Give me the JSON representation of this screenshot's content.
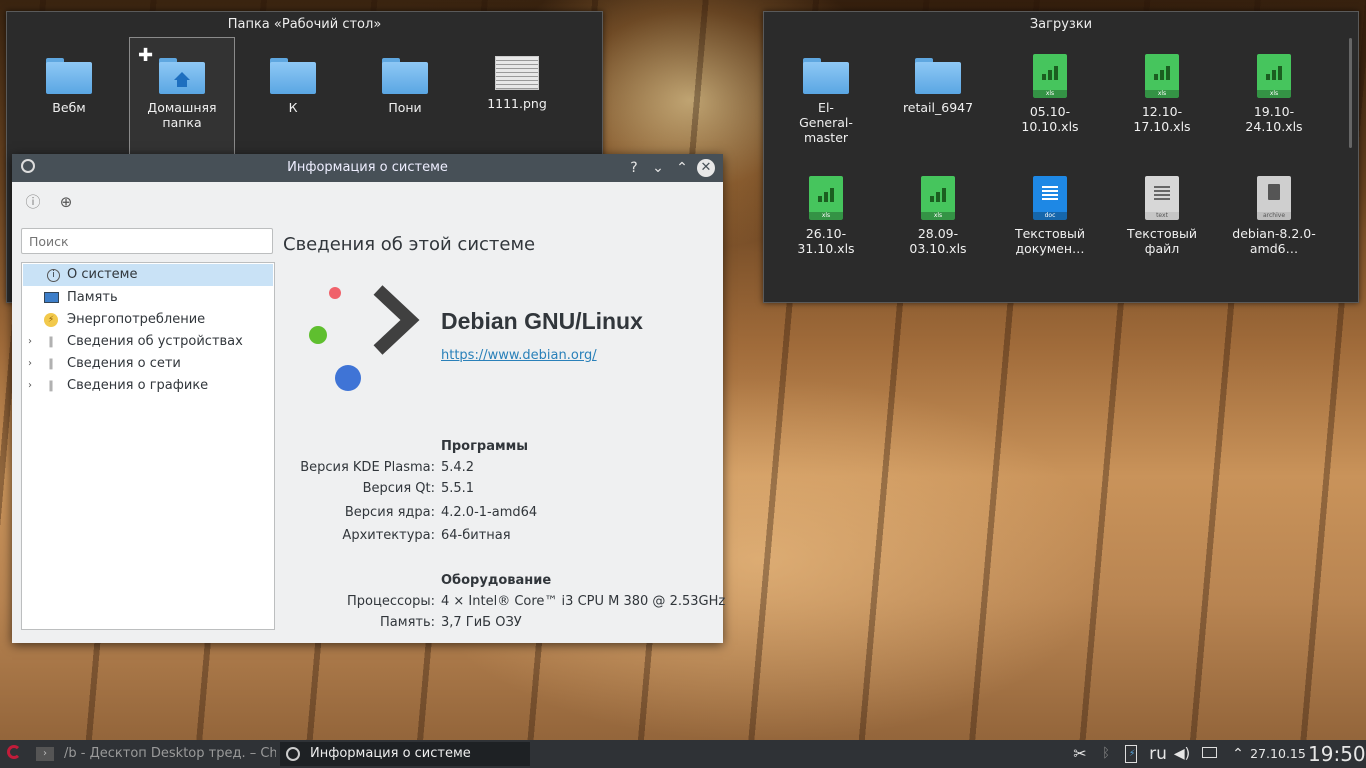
{
  "desktop_folder": {
    "title": "Папка «Рабочий стол»",
    "items": [
      {
        "label": "Вебм",
        "type": "folder"
      },
      {
        "label": "Домашняя папка",
        "type": "home-folder"
      },
      {
        "label": "К",
        "type": "folder"
      },
      {
        "label": "Пони",
        "type": "folder"
      },
      {
        "label": "1111.png",
        "type": "image"
      }
    ]
  },
  "downloads": {
    "title": "Загрузки",
    "items": [
      {
        "label": "El-General-master",
        "type": "folder"
      },
      {
        "label": "retail_6947",
        "type": "folder"
      },
      {
        "label": "05.10-10.10.xls",
        "type": "xls",
        "ext": "xls"
      },
      {
        "label": "12.10-17.10.xls",
        "type": "xls",
        "ext": "xls"
      },
      {
        "label": "19.10-24.10.xls",
        "type": "xls",
        "ext": "xls"
      },
      {
        "label": "26.10-31.10.xls",
        "type": "xls",
        "ext": "xls"
      },
      {
        "label": "28.09-03.10.xls",
        "type": "xls",
        "ext": "xls"
      },
      {
        "label": "Текстовый докумен…",
        "type": "doc",
        "ext": "doc"
      },
      {
        "label": "Текстовый файл",
        "type": "txt",
        "ext": "text"
      },
      {
        "label": "debian-8.2.0-amd6…",
        "type": "archive",
        "ext": "archive"
      }
    ]
  },
  "info_window": {
    "title": "Информация о системе",
    "search_placeholder": "Поиск",
    "tree": [
      {
        "label": "О системе",
        "icon": "info-icon",
        "selected": true
      },
      {
        "label": "Память",
        "icon": "monitor-icon"
      },
      {
        "label": "Энергопотребление",
        "icon": "battery-icon"
      },
      {
        "label": "Сведения об устройствах",
        "icon": "paperclip-icon",
        "expandable": true
      },
      {
        "label": "Сведения о сети",
        "icon": "paperclip-icon",
        "expandable": true
      },
      {
        "label": "Сведения о графике",
        "icon": "paperclip-icon",
        "expandable": true
      }
    ],
    "heading": "Сведения об этой системе",
    "distro_name": "Debian GNU/Linux",
    "distro_url": "https://www.debian.org/",
    "software_header": "Программы",
    "software": [
      {
        "key": "Версия KDE Plasma:",
        "value": "5.4.2"
      },
      {
        "key": "Версия Qt:",
        "value": "5.5.1"
      },
      {
        "key": "Версия ядра:",
        "value": "4.2.0-1-amd64"
      },
      {
        "key": "Архитектура:",
        "value": "64-битная"
      }
    ],
    "hardware_header": "Оборудование",
    "hardware": [
      {
        "key": "Процессоры:",
        "value": "4 × Intel® Core™ i3 CPU M 380 @ 2.53GHz"
      },
      {
        "key": "Память:",
        "value": "3,7 ГиБ ОЗУ"
      }
    ]
  },
  "taskbar": {
    "tasks": [
      {
        "label": "/b - Десктоп Desktop тред. – Chromium"
      },
      {
        "label": "Информация о системе"
      }
    ],
    "keyboard_layout": "ru",
    "date": "27.10.15",
    "time": "19:50"
  }
}
